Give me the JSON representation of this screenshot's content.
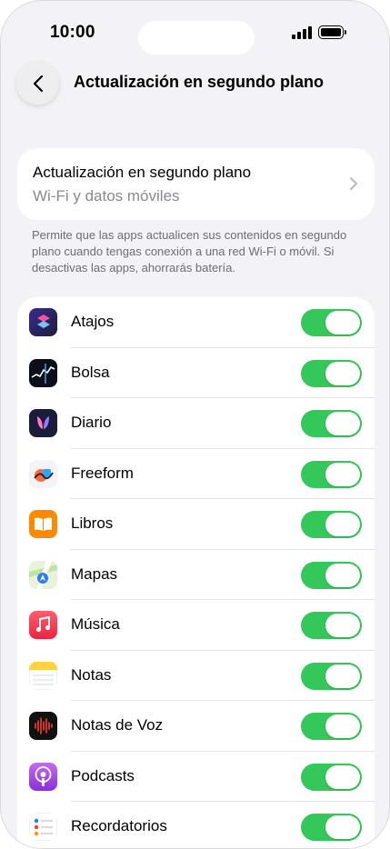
{
  "status_bar": {
    "time": "10:00"
  },
  "nav": {
    "title": "Actualización en segundo plano"
  },
  "summary": {
    "title": "Actualización en segundo plano",
    "value": "Wi-Fi y datos móviles"
  },
  "footnote": "Permite que las apps actualicen sus contenidos en segundo plano cuando tengas conexión a una red Wi-Fi o móvil. Si desactivas las apps, ahorrarás batería.",
  "apps": [
    {
      "label": "Atajos",
      "icon": "shortcuts-icon",
      "enabled": true
    },
    {
      "label": "Bolsa",
      "icon": "stocks-icon",
      "enabled": true
    },
    {
      "label": "Diario",
      "icon": "journal-icon",
      "enabled": true
    },
    {
      "label": "Freeform",
      "icon": "freeform-icon",
      "enabled": true
    },
    {
      "label": "Libros",
      "icon": "books-icon",
      "enabled": true
    },
    {
      "label": "Mapas",
      "icon": "maps-icon",
      "enabled": true
    },
    {
      "label": "Música",
      "icon": "music-icon",
      "enabled": true
    },
    {
      "label": "Notas",
      "icon": "notes-icon",
      "enabled": true
    },
    {
      "label": "Notas de Voz",
      "icon": "voice-memos-icon",
      "enabled": true
    },
    {
      "label": "Podcasts",
      "icon": "podcasts-icon",
      "enabled": true
    },
    {
      "label": "Recordatorios",
      "icon": "reminders-icon",
      "enabled": true
    }
  ],
  "colors": {
    "toggle_on": "#34c759",
    "background": "#f2f2f7",
    "secondary_text": "#8a8a8e"
  }
}
